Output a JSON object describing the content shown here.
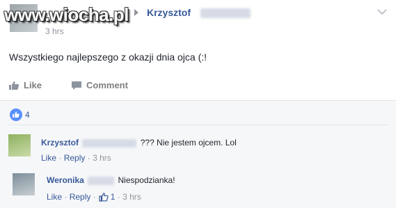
{
  "post": {
    "watermark": "www.wiocha.pl",
    "author": "Krzysztof",
    "timestamp": "3 hrs",
    "text": "Wszystkiego najlepszego z okazji dnia ojca (:!",
    "actions": {
      "like": "Like",
      "comment": "Comment"
    },
    "reactions": {
      "count": "4"
    }
  },
  "comments": [
    {
      "author": "Krzysztof",
      "text": "??? Nie jestem ojcem. Lol",
      "like": "Like",
      "reply": "Reply",
      "separator": "·",
      "time": "3 hrs"
    },
    {
      "author": "Weronika",
      "text": "Niespodzianka!",
      "like": "Like",
      "reply": "Reply",
      "separator": "·",
      "likes": "1",
      "time": "3 hrs"
    }
  ],
  "colors": {
    "link": "#365899",
    "muted": "#90949c",
    "text": "#1d2129",
    "background_comments": "#f6f7f9"
  }
}
